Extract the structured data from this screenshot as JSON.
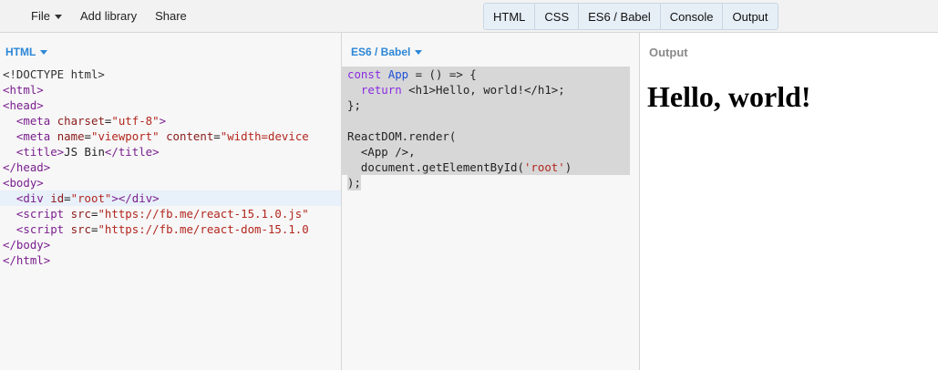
{
  "toolbar": {
    "menu": {
      "file": "File",
      "add_library": "Add library",
      "share": "Share"
    },
    "panels": [
      "HTML",
      "CSS",
      "ES6 / Babel",
      "Console",
      "Output"
    ]
  },
  "html_panel": {
    "label": "HTML",
    "lines": [
      [
        {
          "c": "c-doc",
          "t": "<!DOCTYPE html>"
        }
      ],
      [
        {
          "c": "c-tag",
          "t": "<html>"
        }
      ],
      [
        {
          "c": "c-tag",
          "t": "<head>"
        }
      ],
      [
        {
          "c": "c-text",
          "t": "  "
        },
        {
          "c": "c-tag",
          "t": "<meta "
        },
        {
          "c": "c-attr",
          "t": "charset"
        },
        {
          "c": "c-text",
          "t": "="
        },
        {
          "c": "c-str",
          "t": "\"utf-8\""
        },
        {
          "c": "c-tag",
          "t": ">"
        }
      ],
      [
        {
          "c": "c-text",
          "t": "  "
        },
        {
          "c": "c-tag",
          "t": "<meta "
        },
        {
          "c": "c-attr",
          "t": "name"
        },
        {
          "c": "c-text",
          "t": "="
        },
        {
          "c": "c-str",
          "t": "\"viewport\""
        },
        {
          "c": "c-text",
          "t": " "
        },
        {
          "c": "c-attr",
          "t": "content"
        },
        {
          "c": "c-text",
          "t": "="
        },
        {
          "c": "c-str",
          "t": "\"width=device"
        }
      ],
      [
        {
          "c": "c-text",
          "t": "  "
        },
        {
          "c": "c-tag",
          "t": "<title>"
        },
        {
          "c": "c-text",
          "t": "JS Bin"
        },
        {
          "c": "c-tag",
          "t": "</title>"
        }
      ],
      [
        {
          "c": "c-tag",
          "t": "</head>"
        }
      ],
      [
        {
          "c": "c-tag",
          "t": "<body>"
        }
      ],
      [
        {
          "c": "c-text",
          "t": "  "
        },
        {
          "c": "c-tag",
          "t": "<div "
        },
        {
          "c": "c-attr",
          "t": "id"
        },
        {
          "c": "c-text",
          "t": "="
        },
        {
          "c": "c-str",
          "t": "\"root\""
        },
        {
          "c": "c-tag",
          "t": "></div>"
        }
      ],
      [
        {
          "c": "c-text",
          "t": "  "
        },
        {
          "c": "c-tag",
          "t": "<script "
        },
        {
          "c": "c-attr",
          "t": "src"
        },
        {
          "c": "c-text",
          "t": "="
        },
        {
          "c": "c-str",
          "t": "\"https://fb.me/react-15.1.0.js\""
        }
      ],
      [
        {
          "c": "c-text",
          "t": "  "
        },
        {
          "c": "c-tag",
          "t": "<script "
        },
        {
          "c": "c-attr",
          "t": "src"
        },
        {
          "c": "c-text",
          "t": "="
        },
        {
          "c": "c-str",
          "t": "\"https://fb.me/react-dom-15.1.0"
        }
      ],
      [
        {
          "c": "c-tag",
          "t": "</body>"
        }
      ],
      [
        {
          "c": "c-tag",
          "t": "</html>"
        }
      ]
    ],
    "active_line": 8
  },
  "js_panel": {
    "label": "ES6 / Babel",
    "lines": [
      [
        {
          "c": "c-kw",
          "t": "const "
        },
        {
          "c": "c-def",
          "t": "App"
        },
        {
          "c": "c-plain",
          "t": " = () => {"
        }
      ],
      [
        {
          "c": "c-plain",
          "t": "  "
        },
        {
          "c": "c-kw",
          "t": "return"
        },
        {
          "c": "c-plain",
          "t": " <h1>Hello, world!</h1>;"
        }
      ],
      [
        {
          "c": "c-plain",
          "t": "};"
        }
      ],
      [
        {
          "c": "c-plain",
          "t": ""
        }
      ],
      [
        {
          "c": "c-plain",
          "t": "ReactDOM.render("
        }
      ],
      [
        {
          "c": "c-plain",
          "t": "  <App />,"
        }
      ],
      [
        {
          "c": "c-plain",
          "t": "  document.getElementById("
        },
        {
          "c": "c-str",
          "t": "'root'"
        },
        {
          "c": "c-plain",
          "t": ")"
        }
      ],
      [
        {
          "c": "c-plain",
          "t": ");"
        }
      ]
    ]
  },
  "output_panel": {
    "label": "Output",
    "heading": "Hello, world!"
  }
}
